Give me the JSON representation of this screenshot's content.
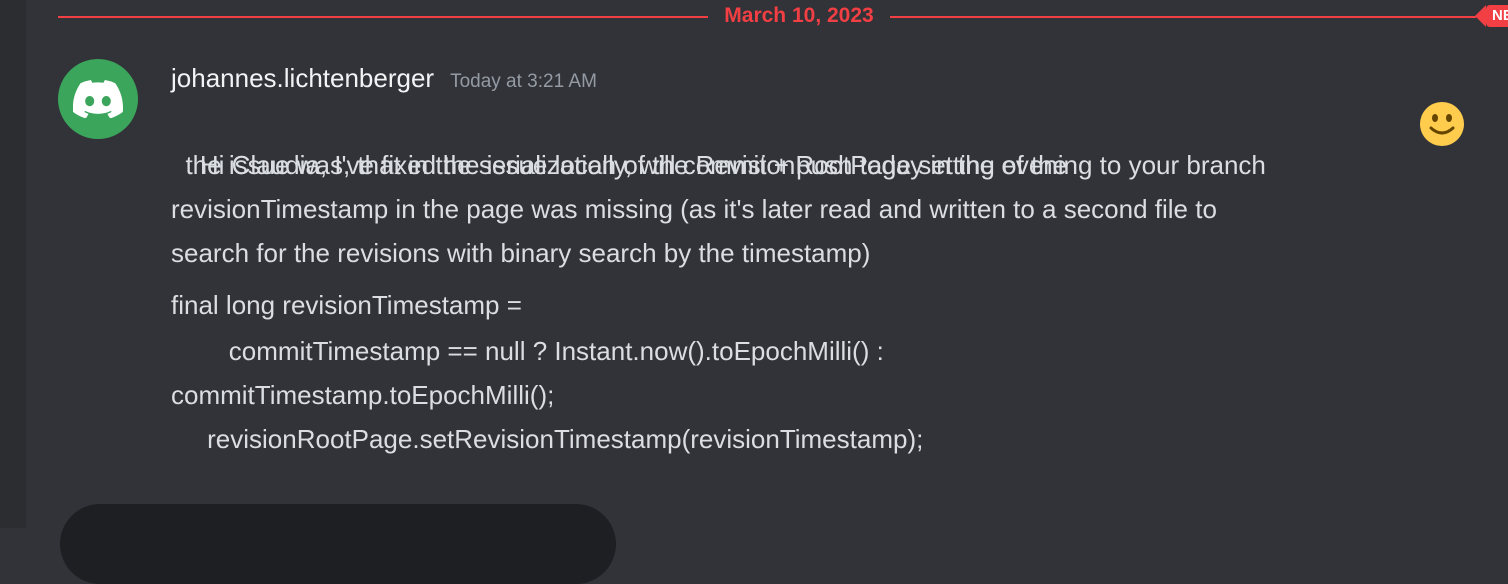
{
  "divider": {
    "date": "March 10, 2023",
    "new_badge": "NEW"
  },
  "message": {
    "author": "johannes.lichtenberger",
    "timestamp": "Today at 3:21 AM",
    "avatar_icon": "discord-logo-icon",
    "avatar_color": "#3ba55c",
    "lines": [
      "Hi Claudia, I've fixed the issue locally, will commit + push today in the evening to your branch",
      "  the issue was, that in the serialization of the RevisionRootPage setting of the",
      "revisionTimestamp in the page was missing (as it's later read and written to a second file to",
      "search for the revisions with binary search by the timestamp)",
      "final long revisionTimestamp =",
      "        commitTimestamp == null ? Instant.now().toEpochMilli() :",
      "commitTimestamp.toEpochMilli();",
      "     revisionRootPage.setRevisionTimestamp(revisionTimestamp);"
    ],
    "emoji": "slightly-smiling-face-icon"
  },
  "colors": {
    "background": "#313338",
    "accent_red": "#f23f43",
    "username": "#f2f3f5",
    "text": "#dbdee1",
    "muted": "#949ba4"
  }
}
